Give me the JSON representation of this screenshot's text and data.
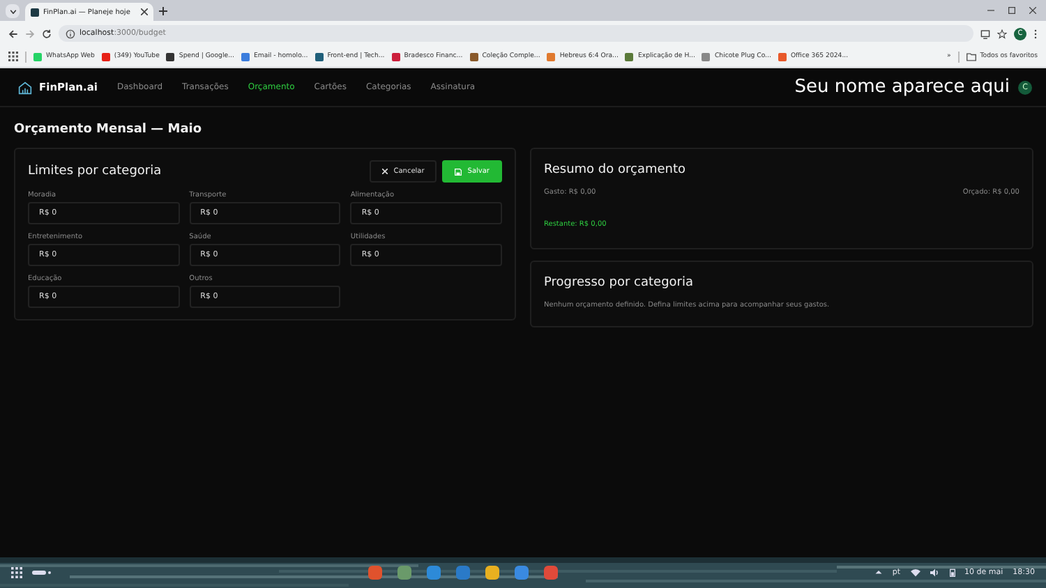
{
  "browser": {
    "tab_title": "FinPlan.ai — Planeje hoje",
    "url_host": "localhost",
    "url_path": ":3000/budget",
    "profile": "C",
    "bookmarks": [
      {
        "label": "WhatsApp Web",
        "color": "#25d366"
      },
      {
        "label": "(349) YouTube",
        "color": "#e62117"
      },
      {
        "label": "Spend | Google...",
        "color": "#333333"
      },
      {
        "label": "Email - homolo...",
        "color": "#3b7ddd"
      },
      {
        "label": "Front-end | Tech...",
        "color": "#1f5f7a"
      },
      {
        "label": "Bradesco Financ...",
        "color": "#cc1f3c"
      },
      {
        "label": "Coleção Comple...",
        "color": "#8a5a2b"
      },
      {
        "label": "Hebreus 6:4 Ora...",
        "color": "#e07a2f"
      },
      {
        "label": "Explicação de H...",
        "color": "#5a7a3a"
      },
      {
        "label": "Chicote Plug Co...",
        "color": "#888888"
      },
      {
        "label": "Office 365 2024...",
        "color": "#e8592a"
      }
    ],
    "more": "»",
    "all_bookmarks": "Todos os favoritos"
  },
  "app": {
    "logo": "FinPlan.ai",
    "nav": [
      {
        "label": "Dashboard",
        "selected": false
      },
      {
        "label": "Transações",
        "selected": false
      },
      {
        "label": "Orçamento",
        "selected": true
      },
      {
        "label": "Cartões",
        "selected": false
      },
      {
        "label": "Categorias",
        "selected": false
      },
      {
        "label": "Assinatura",
        "selected": false
      }
    ],
    "user_name": "Seu nome aparece aqui",
    "avatar": "C"
  },
  "page_title": "Orçamento Mensal — Maio",
  "limits": {
    "title": "Limites por categoria",
    "cancel": "Cancelar",
    "save": "Salvar",
    "fields": [
      {
        "label": "Moradia",
        "value": "R$ 0"
      },
      {
        "label": "Transporte",
        "value": "R$ 0"
      },
      {
        "label": "Alimentação",
        "value": "R$ 0"
      },
      {
        "label": "Entretenimento",
        "value": "R$ 0"
      },
      {
        "label": "Saúde",
        "value": "R$ 0"
      },
      {
        "label": "Utilidades",
        "value": "R$ 0"
      },
      {
        "label": "Educação",
        "value": "R$ 0"
      },
      {
        "label": "Outros",
        "value": "R$ 0"
      }
    ]
  },
  "summary": {
    "title": "Resumo do orçamento",
    "spent": "Gasto: R$ 0,00",
    "budget": "Orçado: R$ 0,00",
    "remaining": "Restante: R$ 0,00"
  },
  "progress": {
    "title": "Progresso por categoria",
    "empty": "Nenhum orçamento definido. Defina limites acima para acompanhar seus gastos."
  },
  "taskbar": {
    "apps": [
      {
        "color": "#e0522d"
      },
      {
        "color": "#6a9a6a"
      },
      {
        "color": "#2d8ad8"
      },
      {
        "color": "#2a7ac8"
      },
      {
        "color": "#e8b020"
      },
      {
        "color": "#3a8ae0"
      },
      {
        "color": "#e04a3a"
      }
    ],
    "lang": "pt",
    "date": "10 de mai",
    "time": "18:30"
  }
}
